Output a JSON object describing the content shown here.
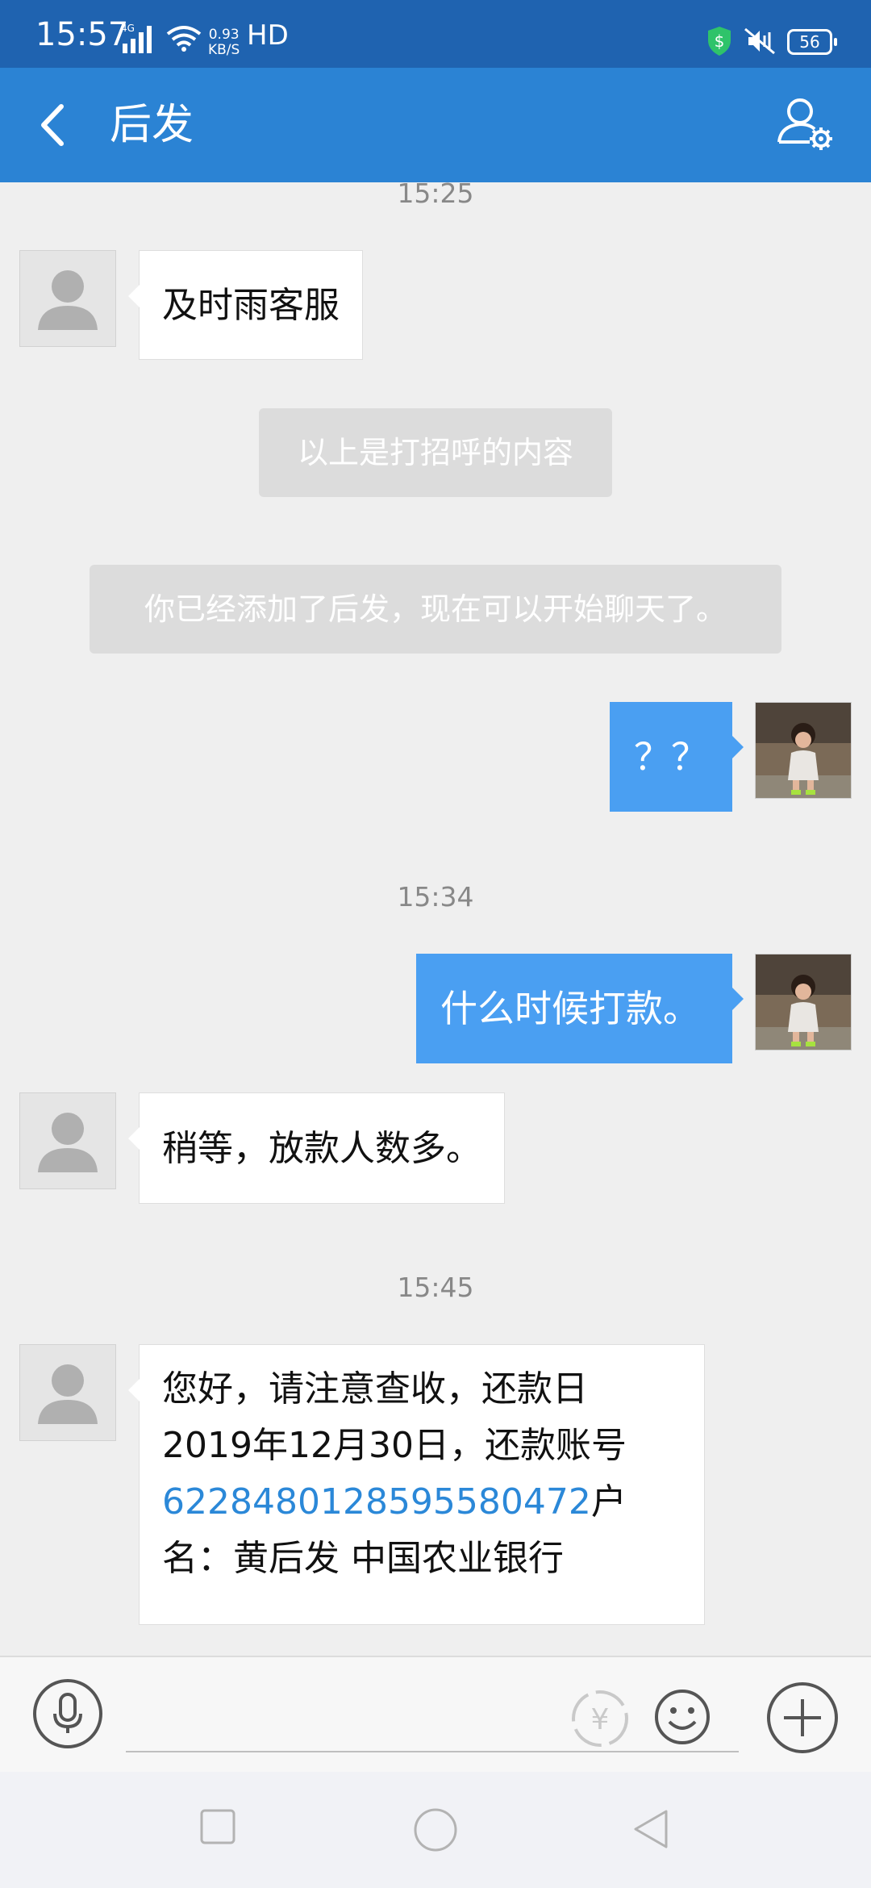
{
  "status_bar": {
    "time": "15:57",
    "network": "4G",
    "speed_value": "0.93",
    "speed_unit": "KB/S",
    "hd": "HD",
    "battery": "56"
  },
  "header": {
    "title": "后发",
    "back_icon": "chevron-left-icon",
    "settings_icon": "user-settings-icon"
  },
  "chat": {
    "timestamps": [
      "15:25",
      "15:34",
      "15:45"
    ],
    "messages": [
      {
        "from": "contact",
        "text": "及时雨客服"
      },
      {
        "from": "system",
        "text": "以上是打招呼的内容"
      },
      {
        "from": "system",
        "text": "你已经添加了后发，现在可以开始聊天了。"
      },
      {
        "from": "me",
        "text": "？？"
      },
      {
        "from": "me",
        "text": "什么时候打款。"
      },
      {
        "from": "contact",
        "text": "稍等，放款人数多。"
      },
      {
        "from": "contact",
        "line1": "您好，请注意查收，还款日",
        "line2": "2019年12月30日，还款账号",
        "account_number": "6228480128595580472",
        "line3_suffix": "户",
        "line4": "名：黄后发 中国农业银行"
      }
    ]
  },
  "input_bar": {
    "placeholder": "",
    "icons": [
      "microphone-icon",
      "red-packet-icon",
      "emoji-icon",
      "plus-icon"
    ]
  },
  "nav_bar": {
    "icons": [
      "square-recents-icon",
      "circle-home-icon",
      "triangle-back-icon"
    ]
  },
  "colors": {
    "header": "#2b83d4",
    "status_bar": "#1f63b0",
    "outgoing_bubble": "#4a9ff2",
    "link": "#2b88d8",
    "background": "#efefef"
  }
}
